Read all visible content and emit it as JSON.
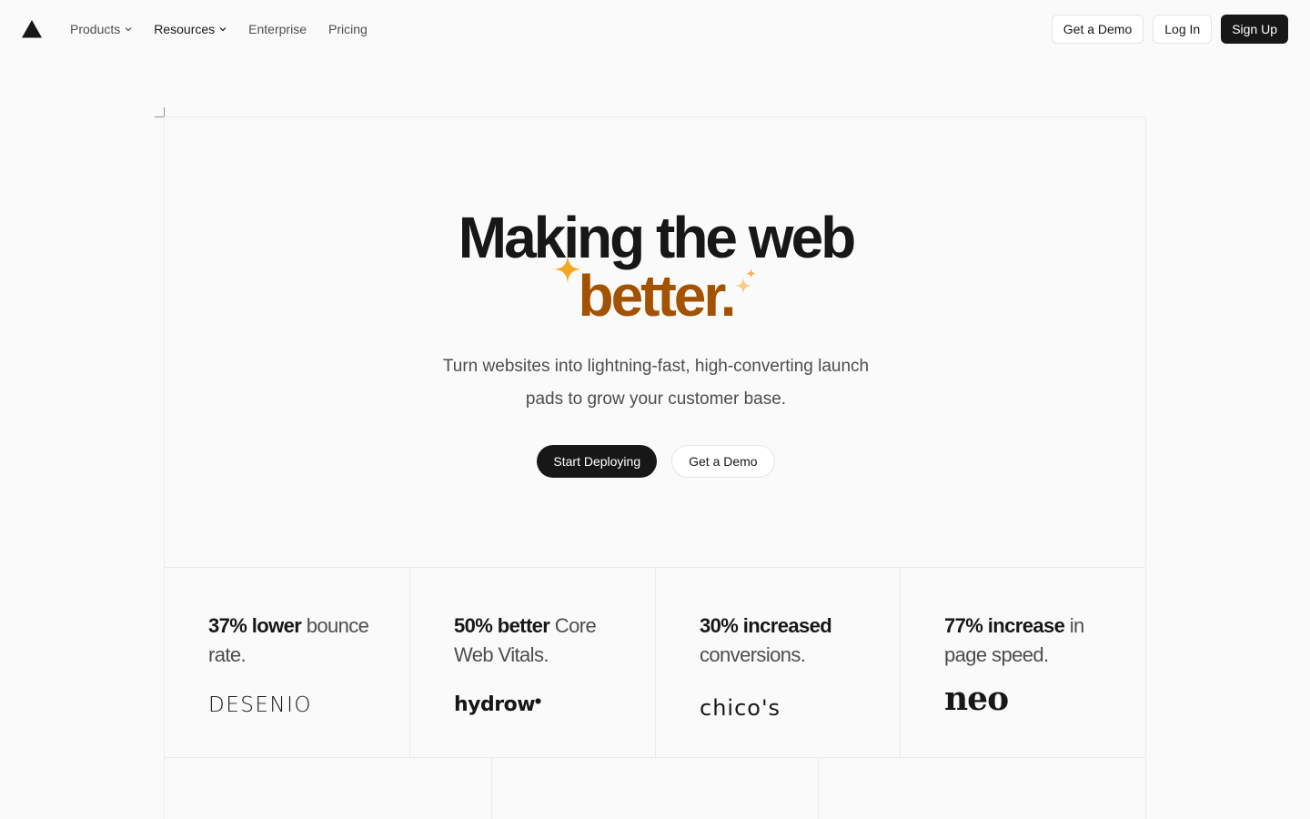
{
  "nav": {
    "logo_icon": "triangle-logo-icon",
    "links": [
      {
        "label": "Products",
        "has_dropdown": true
      },
      {
        "label": "Resources",
        "has_dropdown": true
      },
      {
        "label": "Enterprise",
        "has_dropdown": false
      },
      {
        "label": "Pricing",
        "has_dropdown": false
      }
    ],
    "get_demo": "Get a Demo",
    "log_in": "Log In",
    "sign_up": "Sign Up"
  },
  "hero": {
    "title_line1": "Making the web",
    "title_line2": "better.",
    "accent_color": "#a35200",
    "sparkle_color": "#f5a623",
    "subtitle": "Turn websites into lightning-fast, high-converting launch pads to grow your customer base.",
    "primary_cta": "Start Deploying",
    "secondary_cta": "Get a Demo"
  },
  "stats": [
    {
      "bold": "37% lower",
      "rest": " bounce rate.",
      "brand": "DESENIO"
    },
    {
      "bold": "50% better",
      "rest": " Core Web Vitals.",
      "brand": "hydrow"
    },
    {
      "bold": "30% increased",
      "rest": " conversions.",
      "brand": "chico's"
    },
    {
      "bold": "77% increase",
      "rest": " in page speed.",
      "brand": "neo"
    }
  ]
}
